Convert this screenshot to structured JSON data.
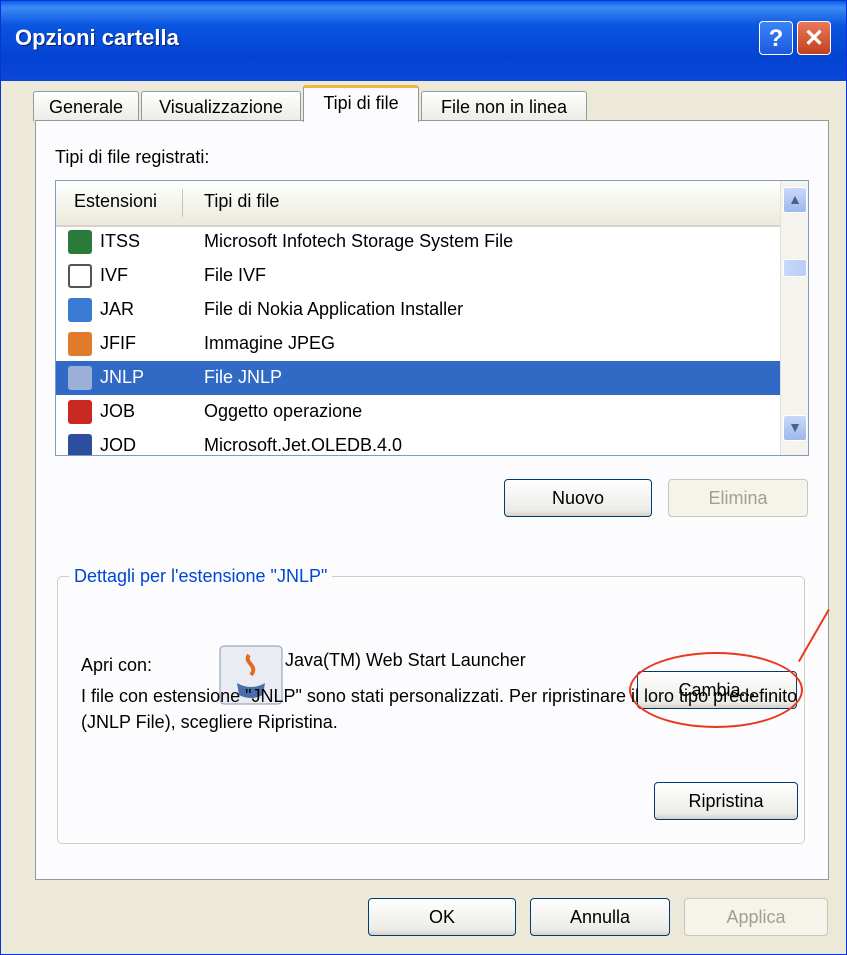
{
  "window": {
    "title": "Opzioni cartella"
  },
  "titlebar": {
    "help_label": "?",
    "close_label": "✕"
  },
  "tabs": [
    {
      "label": "Generale"
    },
    {
      "label": "Visualizzazione"
    },
    {
      "label": "Tipi di file"
    },
    {
      "label": "File non in linea"
    }
  ],
  "active_tab": "Tipi di file",
  "file_types": {
    "label": "Tipi di file registrati:",
    "columns": [
      "Estensioni",
      "Tipi di file"
    ],
    "rows": [
      {
        "ext": "ITSS",
        "type": "Microsoft Infotech Storage System File",
        "icon": "itss-file-icon",
        "color": "#2a7a3a"
      },
      {
        "ext": "IVF",
        "type": "File IVF",
        "icon": "ivf-file-icon",
        "color": "#555555"
      },
      {
        "ext": "JAR",
        "type": "File di Nokia Application Installer",
        "icon": "jar-file-icon",
        "color": "#3a7bd5"
      },
      {
        "ext": "JFIF",
        "type": "Immagine JPEG",
        "icon": "jpeg-file-icon",
        "color": "#e07b2a"
      },
      {
        "ext": "JNLP",
        "type": "File JNLP",
        "icon": "jnlp-file-icon",
        "color": "#9ab0d6",
        "selected": true
      },
      {
        "ext": "JOB",
        "type": "Oggetto operazione",
        "icon": "job-file-icon",
        "color": "#c8281f"
      },
      {
        "ext": "JOD",
        "type": "Microsoft.Jet.OLEDB.4.0",
        "icon": "jod-file-icon",
        "color": "#2b4f9e"
      }
    ],
    "scroll_up": "▲",
    "scroll_down": "▼"
  },
  "list_buttons": {
    "new_label": "Nuovo",
    "delete_label": "Elimina"
  },
  "details": {
    "title": "Dettagli per l'estensione \"JNLP\"",
    "open_with_label": "Apri con:",
    "app_name": "Java(TM) Web Start Launcher",
    "change_label": "Cambia...",
    "description": "I file con estensione \"JNLP\" sono stati personalizzati. Per ripristinare il loro tipo predefinito (JNLP File), scegliere Ripristina.",
    "restore_label": "Ripristina"
  },
  "footer": {
    "ok_label": "OK",
    "cancel_label": "Annulla",
    "apply_label": "Applica"
  },
  "colors": {
    "titlebar": "#0343d2",
    "selection": "#316ac5",
    "annotation": "#e8391d",
    "group_title": "#0046d5"
  }
}
